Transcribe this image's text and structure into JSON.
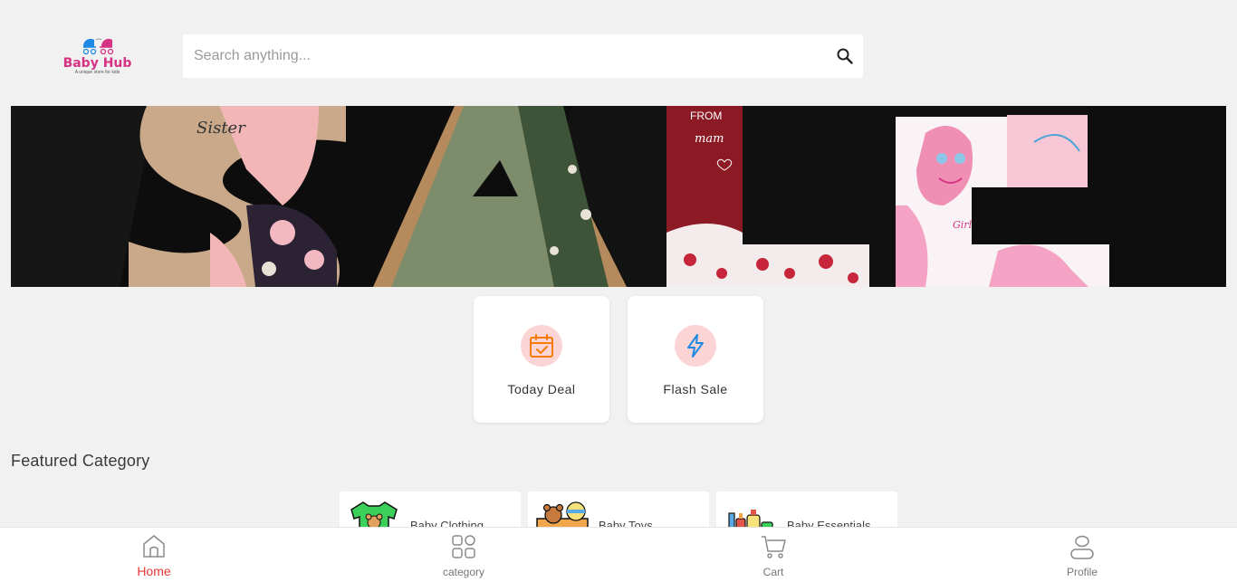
{
  "brand": {
    "name": "Baby Hub",
    "tagline": "A unique store for kids",
    "primary_color": "#d63384",
    "secondary_color": "#1e88e5"
  },
  "search": {
    "placeholder": "Search anything...",
    "value": "",
    "icon": "search-icon"
  },
  "banner": {
    "text": "SALE",
    "print_on_clothing": [
      "Sister",
      "FROM",
      "mam",
      "Girl"
    ]
  },
  "quick_links": [
    {
      "label": "Today Deal",
      "icon": "calendar-check-icon",
      "color": "#f57c00"
    },
    {
      "label": "Flash Sale",
      "icon": "lightning-icon",
      "color": "#1e88e5"
    }
  ],
  "featured": {
    "title": "Featured Category",
    "categories": [
      {
        "label": "Baby Clothing",
        "icon": "baby-clothing-icon"
      },
      {
        "label": "Baby Toys",
        "icon": "baby-toys-icon"
      },
      {
        "label": "Baby Essentials",
        "icon": "baby-essentials-icon"
      }
    ]
  },
  "nav": {
    "items": [
      {
        "label": "Home",
        "icon": "home-icon",
        "active": true
      },
      {
        "label": "category",
        "icon": "grid-icon",
        "active": false
      },
      {
        "label": "Cart",
        "icon": "cart-icon",
        "active": false
      },
      {
        "label": "Profile",
        "icon": "user-icon",
        "active": false
      }
    ],
    "active_color": "#e53935"
  }
}
